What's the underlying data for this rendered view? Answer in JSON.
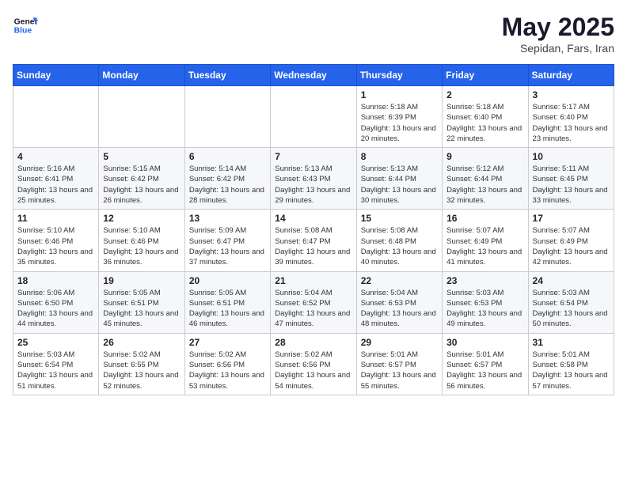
{
  "header": {
    "logo_line1": "General",
    "logo_line2": "Blue",
    "month": "May 2025",
    "location": "Sepidan, Fars, Iran"
  },
  "weekdays": [
    "Sunday",
    "Monday",
    "Tuesday",
    "Wednesday",
    "Thursday",
    "Friday",
    "Saturday"
  ],
  "weeks": [
    [
      {
        "day": "",
        "info": ""
      },
      {
        "day": "",
        "info": ""
      },
      {
        "day": "",
        "info": ""
      },
      {
        "day": "",
        "info": ""
      },
      {
        "day": "1",
        "info": "Sunrise: 5:18 AM\nSunset: 6:39 PM\nDaylight: 13 hours and 20 minutes."
      },
      {
        "day": "2",
        "info": "Sunrise: 5:18 AM\nSunset: 6:40 PM\nDaylight: 13 hours and 22 minutes."
      },
      {
        "day": "3",
        "info": "Sunrise: 5:17 AM\nSunset: 6:40 PM\nDaylight: 13 hours and 23 minutes."
      }
    ],
    [
      {
        "day": "4",
        "info": "Sunrise: 5:16 AM\nSunset: 6:41 PM\nDaylight: 13 hours and 25 minutes."
      },
      {
        "day": "5",
        "info": "Sunrise: 5:15 AM\nSunset: 6:42 PM\nDaylight: 13 hours and 26 minutes."
      },
      {
        "day": "6",
        "info": "Sunrise: 5:14 AM\nSunset: 6:42 PM\nDaylight: 13 hours and 28 minutes."
      },
      {
        "day": "7",
        "info": "Sunrise: 5:13 AM\nSunset: 6:43 PM\nDaylight: 13 hours and 29 minutes."
      },
      {
        "day": "8",
        "info": "Sunrise: 5:13 AM\nSunset: 6:44 PM\nDaylight: 13 hours and 30 minutes."
      },
      {
        "day": "9",
        "info": "Sunrise: 5:12 AM\nSunset: 6:44 PM\nDaylight: 13 hours and 32 minutes."
      },
      {
        "day": "10",
        "info": "Sunrise: 5:11 AM\nSunset: 6:45 PM\nDaylight: 13 hours and 33 minutes."
      }
    ],
    [
      {
        "day": "11",
        "info": "Sunrise: 5:10 AM\nSunset: 6:46 PM\nDaylight: 13 hours and 35 minutes."
      },
      {
        "day": "12",
        "info": "Sunrise: 5:10 AM\nSunset: 6:46 PM\nDaylight: 13 hours and 36 minutes."
      },
      {
        "day": "13",
        "info": "Sunrise: 5:09 AM\nSunset: 6:47 PM\nDaylight: 13 hours and 37 minutes."
      },
      {
        "day": "14",
        "info": "Sunrise: 5:08 AM\nSunset: 6:47 PM\nDaylight: 13 hours and 39 minutes."
      },
      {
        "day": "15",
        "info": "Sunrise: 5:08 AM\nSunset: 6:48 PM\nDaylight: 13 hours and 40 minutes."
      },
      {
        "day": "16",
        "info": "Sunrise: 5:07 AM\nSunset: 6:49 PM\nDaylight: 13 hours and 41 minutes."
      },
      {
        "day": "17",
        "info": "Sunrise: 5:07 AM\nSunset: 6:49 PM\nDaylight: 13 hours and 42 minutes."
      }
    ],
    [
      {
        "day": "18",
        "info": "Sunrise: 5:06 AM\nSunset: 6:50 PM\nDaylight: 13 hours and 44 minutes."
      },
      {
        "day": "19",
        "info": "Sunrise: 5:05 AM\nSunset: 6:51 PM\nDaylight: 13 hours and 45 minutes."
      },
      {
        "day": "20",
        "info": "Sunrise: 5:05 AM\nSunset: 6:51 PM\nDaylight: 13 hours and 46 minutes."
      },
      {
        "day": "21",
        "info": "Sunrise: 5:04 AM\nSunset: 6:52 PM\nDaylight: 13 hours and 47 minutes."
      },
      {
        "day": "22",
        "info": "Sunrise: 5:04 AM\nSunset: 6:53 PM\nDaylight: 13 hours and 48 minutes."
      },
      {
        "day": "23",
        "info": "Sunrise: 5:03 AM\nSunset: 6:53 PM\nDaylight: 13 hours and 49 minutes."
      },
      {
        "day": "24",
        "info": "Sunrise: 5:03 AM\nSunset: 6:54 PM\nDaylight: 13 hours and 50 minutes."
      }
    ],
    [
      {
        "day": "25",
        "info": "Sunrise: 5:03 AM\nSunset: 6:54 PM\nDaylight: 13 hours and 51 minutes."
      },
      {
        "day": "26",
        "info": "Sunrise: 5:02 AM\nSunset: 6:55 PM\nDaylight: 13 hours and 52 minutes."
      },
      {
        "day": "27",
        "info": "Sunrise: 5:02 AM\nSunset: 6:56 PM\nDaylight: 13 hours and 53 minutes."
      },
      {
        "day": "28",
        "info": "Sunrise: 5:02 AM\nSunset: 6:56 PM\nDaylight: 13 hours and 54 minutes."
      },
      {
        "day": "29",
        "info": "Sunrise: 5:01 AM\nSunset: 6:57 PM\nDaylight: 13 hours and 55 minutes."
      },
      {
        "day": "30",
        "info": "Sunrise: 5:01 AM\nSunset: 6:57 PM\nDaylight: 13 hours and 56 minutes."
      },
      {
        "day": "31",
        "info": "Sunrise: 5:01 AM\nSunset: 6:58 PM\nDaylight: 13 hours and 57 minutes."
      }
    ]
  ]
}
